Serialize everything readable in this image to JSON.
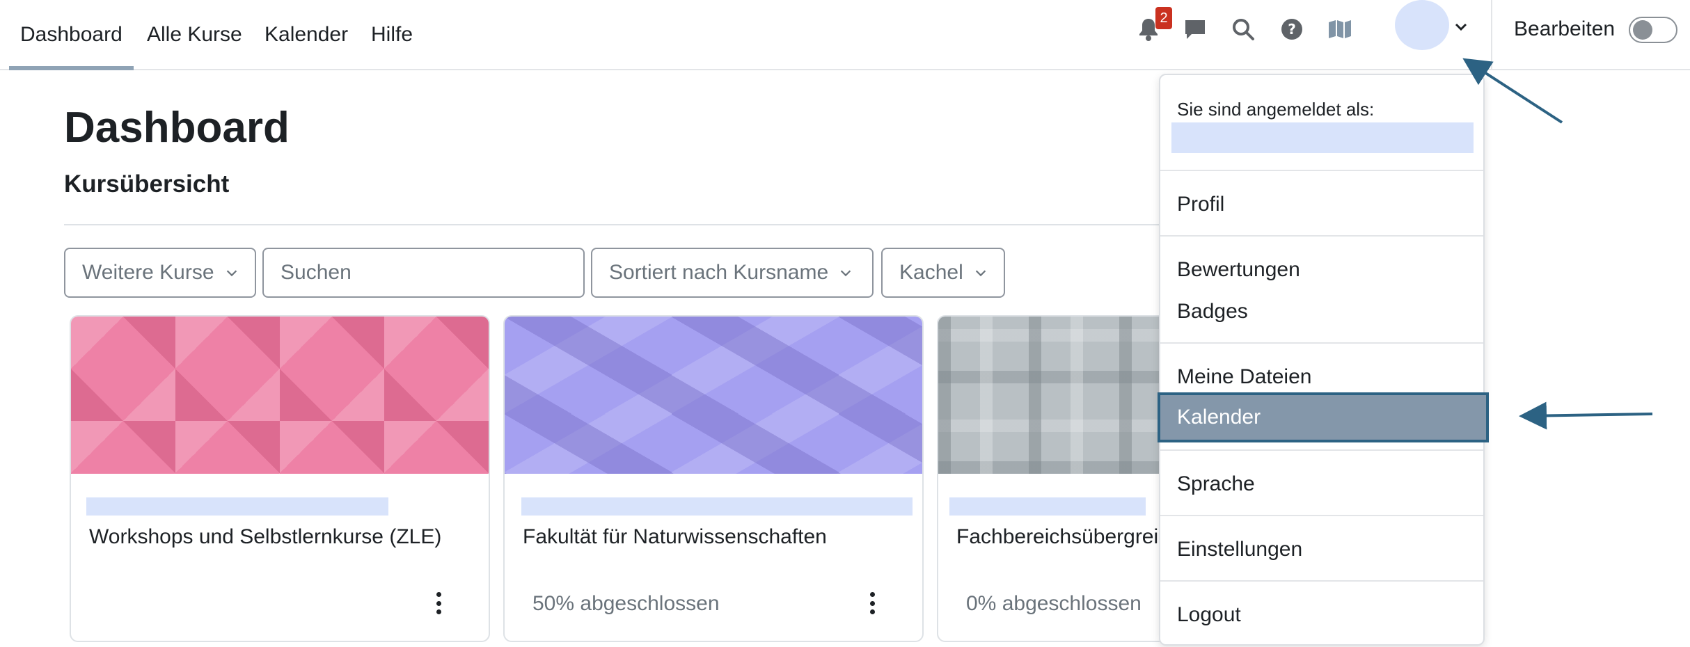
{
  "nav": {
    "links": [
      "Dashboard",
      "Alle Kurse",
      "Kalender",
      "Hilfe"
    ],
    "notification_count": "2",
    "edit_label": "Bearbeiten"
  },
  "main": {
    "title": "Dashboard",
    "section_title": "Kursübersicht",
    "filters": {
      "courses": "Weitere Kurse",
      "search_placeholder": "Suchen",
      "sort": "Sortiert nach Kursname",
      "view": "Kachel"
    },
    "cards": [
      {
        "name": "Workshops und Selbstlernkurse (ZLE)",
        "progress": ""
      },
      {
        "name": "Fakultät für Naturwissenschaften",
        "progress": "50% abgeschlossen"
      },
      {
        "name": "Fachbereichsübergrei",
        "progress": "0% abgeschlossen"
      }
    ]
  },
  "user_menu": {
    "logged_in_as": "Sie sind angemeldet als:",
    "items": [
      "Profil",
      "Bewertungen",
      "Badges",
      "Meine Dateien",
      "Kalender",
      "Sprache",
      "Einstellungen",
      "Logout"
    ]
  },
  "colors": {
    "highlight": "#8497aa",
    "highlight_border": "#2c6283",
    "arrow": "#2c6283",
    "badge": "#ca3120"
  }
}
